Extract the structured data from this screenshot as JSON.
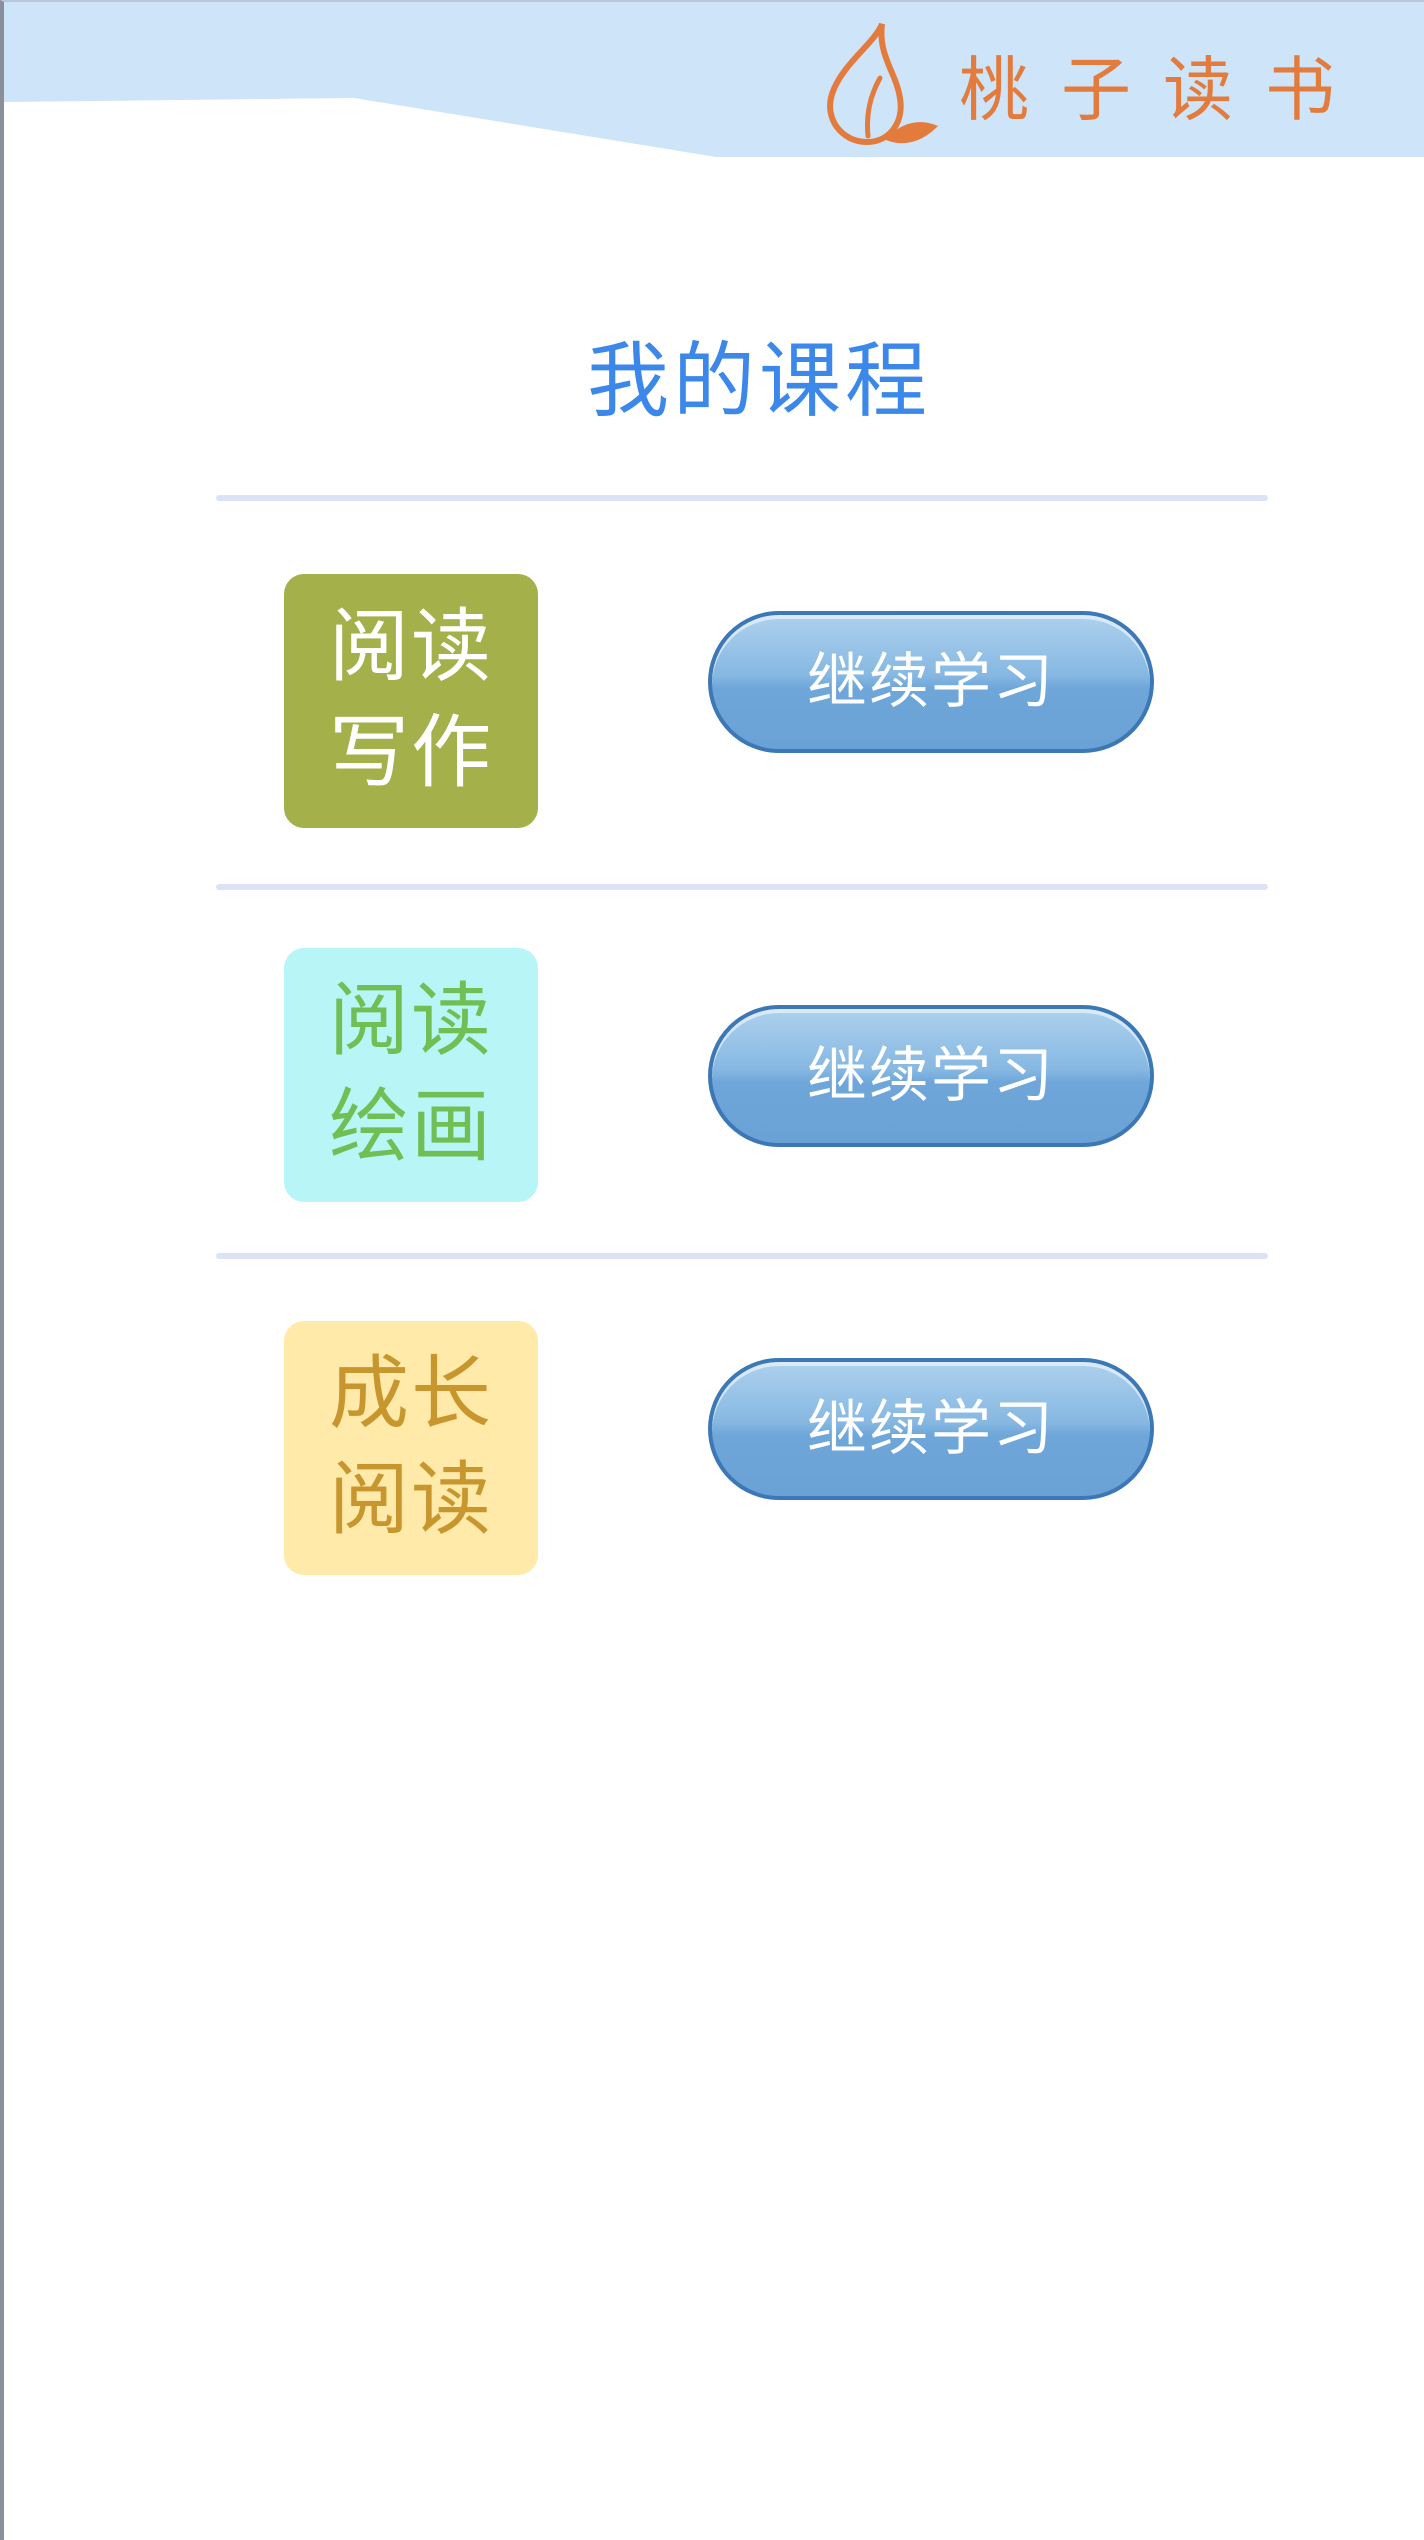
{
  "header": {
    "brand_text": "桃子读书",
    "logo_icon": "peach-icon",
    "colors": {
      "band": "#cde4f9",
      "brand": "#e27b3c"
    }
  },
  "main": {
    "title": "我的课程",
    "title_color": "#3b87ea",
    "courses": [
      {
        "line1": "阅读",
        "line2": "写作",
        "tile_bg": "#a4b049",
        "text_color": "#ffffff",
        "button_label": "继续学习"
      },
      {
        "line1": "阅读",
        "line2": "绘画",
        "tile_bg": "#b7f5f7",
        "text_color": "#6fbf55",
        "button_label": "继续学习"
      },
      {
        "line1": "成长",
        "line2": "阅读",
        "tile_bg": "#ffeaa9",
        "text_color": "#c8962e",
        "button_label": "继续学习"
      }
    ],
    "button_color": "#6ea6d9"
  }
}
